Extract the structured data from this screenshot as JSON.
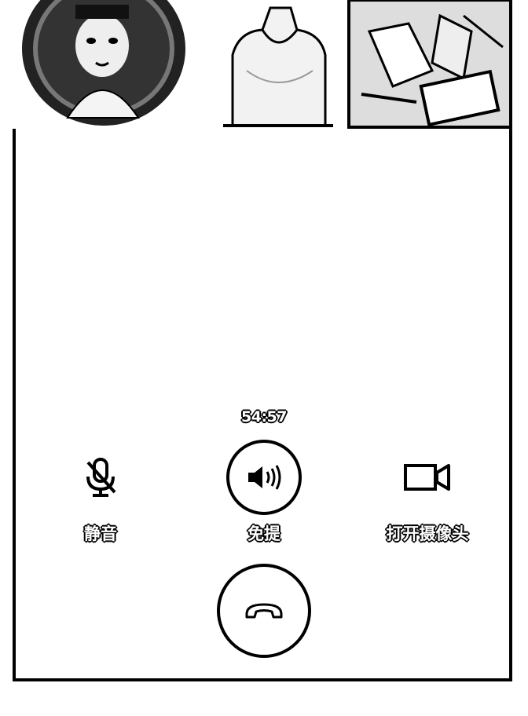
{
  "call": {
    "duration": "54:57"
  },
  "controls": {
    "mute_label": "静音",
    "speaker_label": "免提",
    "camera_label": "打开摄像头"
  },
  "icons": {
    "mute": "mic-off-icon",
    "speaker": "speaker-icon",
    "camera": "video-camera-icon",
    "hangup": "phone-hangup-icon"
  },
  "participants": [
    {
      "name": "participant-1"
    },
    {
      "name": "participant-2"
    },
    {
      "name": "participant-3"
    }
  ]
}
